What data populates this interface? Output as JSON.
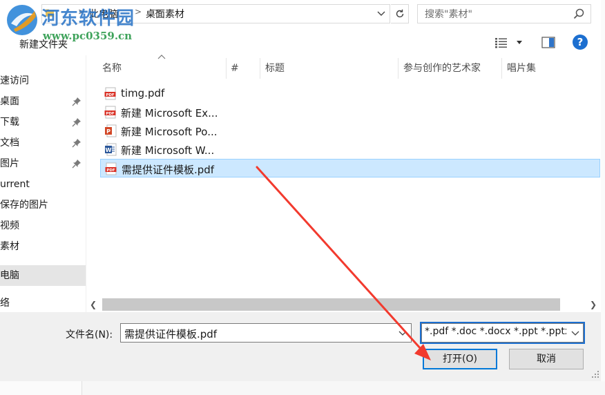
{
  "watermark": {
    "site_name": "河东软件园",
    "url": "www.pc0359.cn"
  },
  "address_bar": {
    "crumbs": [
      "此电脑",
      "桌面",
      "素材"
    ],
    "separator": ">"
  },
  "search": {
    "placeholder": "搜索\"素材\""
  },
  "toolbar": {
    "new_folder_label": "新建文件夹",
    "help_label": "?"
  },
  "nav_pane": {
    "items": [
      {
        "label": "速访问",
        "pinned": false,
        "selected": false
      },
      {
        "label": "桌面",
        "pinned": true,
        "selected": false
      },
      {
        "label": "下载",
        "pinned": true,
        "selected": false
      },
      {
        "label": "文档",
        "pinned": true,
        "selected": false
      },
      {
        "label": "图片",
        "pinned": true,
        "selected": false
      },
      {
        "label": "urrent",
        "pinned": false,
        "selected": false
      },
      {
        "label": "保存的图片",
        "pinned": false,
        "selected": false
      },
      {
        "label": "视频",
        "pinned": false,
        "selected": false
      },
      {
        "label": "素材",
        "pinned": false,
        "selected": false
      },
      {
        "label": "电脑",
        "pinned": false,
        "selected": true
      },
      {
        "label": "络",
        "pinned": false,
        "selected": false
      }
    ]
  },
  "columns": [
    "名称",
    "#",
    "标题",
    "参与创作的艺术家",
    "唱片集"
  ],
  "files": [
    {
      "name": "timg.pdf",
      "type": "pdf",
      "selected": false
    },
    {
      "name": "新建 Microsoft Ex...",
      "type": "pdf",
      "selected": false
    },
    {
      "name": "新建 Microsoft Po...",
      "type": "ppt",
      "selected": false
    },
    {
      "name": "新建 Microsoft W...",
      "type": "word",
      "selected": false
    },
    {
      "name": "需提供证件模板.pdf",
      "type": "pdf",
      "selected": true
    }
  ],
  "bottom": {
    "filename_label": "文件名(N):",
    "filename_value": "需提供证件模板.pdf",
    "filetype_value": "*.pdf *.doc *.docx *.ppt *.pptx",
    "open_button": "打开(O)",
    "cancel_button": "取消"
  },
  "colors": {
    "selection_bg": "#cce8ff",
    "selection_border": "#99d1ff",
    "accent": "#0078d7",
    "annotation_arrow": "#f23a2e",
    "pdf_icon": "#d93025",
    "ppt_icon": "#d24726",
    "word_icon": "#2b579a"
  },
  "icons": {
    "search": "search-icon",
    "refresh": "refresh-icon",
    "pin": "pin-icon",
    "view": "details-view-icon",
    "preview_pane": "preview-pane-icon",
    "help": "help-icon"
  }
}
